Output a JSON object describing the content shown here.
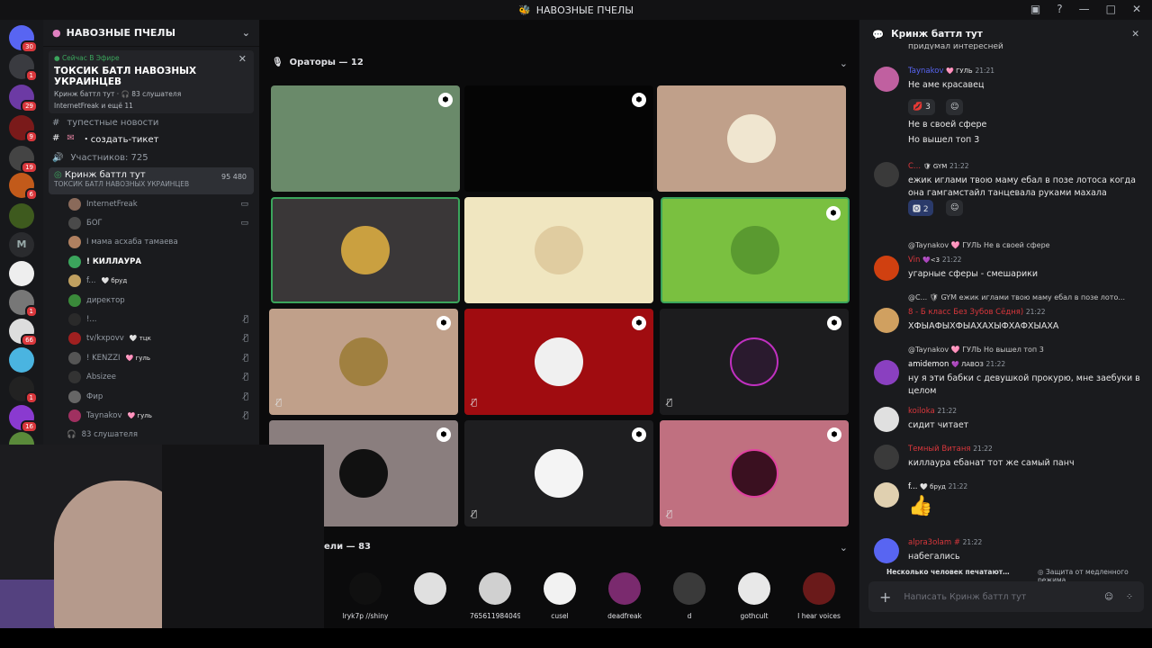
{
  "window": {
    "title": "НАВОЗНЫЕ ПЧЕЛЫ"
  },
  "server": {
    "name": "НАВОЗНЫЕ ПЧЕЛЫ",
    "on_air": "Сейчас В Эфире",
    "stage_title": "ТОКСИК БАТЛ НАВОЗНЫХ УКРАИНЦЕВ",
    "stage_meta": "Кринж баттл тут · 🎧 83 слушателя",
    "stage_users": "InternetFreak и ещё 11"
  },
  "server_badges": [
    "30",
    "1",
    "29",
    "9",
    "19",
    "6",
    "1",
    "66",
    "1",
    "16"
  ],
  "channels": [
    {
      "label": "тупестные новости"
    },
    {
      "label": "・создать-тикет"
    },
    {
      "label": "Участников: 725"
    }
  ],
  "voice_channel": {
    "name": "Кринж баттл тут",
    "sub": "ТОКСИК БАТЛ НАВОЗНЫХ УКРАИНЦЕВ",
    "count": "95  480"
  },
  "voice_users": [
    {
      "name": "InternetFreak",
      "tag": "",
      "right": "▭"
    },
    {
      "name": "БОГ",
      "tag": "",
      "right": "▭"
    },
    {
      "name": "I мама асхаба тамаева",
      "tag": "",
      "right": ""
    },
    {
      "name": "! КИЛЛАУРА",
      "tag": "",
      "right": ""
    },
    {
      "name": "f...",
      "tag": "🤍 бруд",
      "right": ""
    },
    {
      "name": "директор",
      "tag": "",
      "right": ""
    },
    {
      "name": "!...",
      "tag": "",
      "right": "🎙̸"
    },
    {
      "name": "tv/kxpovv",
      "tag": "🤍 тцк",
      "right": "🎙̸"
    },
    {
      "name": "! KENZZI",
      "tag": "🩷 гуль",
      "right": "🎙̸"
    },
    {
      "name": "Absizee",
      "tag": "",
      "right": "🎙̸"
    },
    {
      "name": "Фир",
      "tag": "",
      "right": "🎙̸"
    },
    {
      "name": "Taynakov",
      "tag": "🩷 гуль",
      "right": "🎙̸"
    }
  ],
  "listeners_row": "83 слушателя",
  "stage": {
    "speakers": "Ораторы — 12",
    "listeners": "ели — 83"
  },
  "listeners": [
    {
      "name": "lryk7p //shiny",
      "color": "#101010"
    },
    {
      "name": "",
      "color": "#e0e0e0"
    },
    {
      "name": "765611984049...",
      "color": "#d0d0d0"
    },
    {
      "name": "cusel",
      "color": "#f2f2f2"
    },
    {
      "name": "deadfreak",
      "color": "#7a2a6e"
    },
    {
      "name": "d",
      "color": "#3a3a3a"
    },
    {
      "name": "gothcult",
      "color": "#e8e8e8"
    },
    {
      "name": "I hear voices",
      "color": "#6a1a1a"
    }
  ],
  "chat": {
    "channel": "Кринж баттл тут",
    "cut_text": "придумал интересней",
    "placeholder": "Написать Кринж баттл тут",
    "typing": "Несколько человек печатают…",
    "slowmode": "Защита от медленного режима",
    "messages": [
      {
        "author": "Taynakov",
        "tag": "🩷 ГУЛЬ",
        "time": "21:21",
        "text": "Не аме красавец",
        "react1": "💋 3",
        "react2": "☺",
        "extra1": "Не в своей сфере",
        "extra2": "Но вышел топ 3",
        "color": "#5865f2"
      },
      {
        "author": "C...",
        "tag": "🛡 GYM",
        "time": "21:22",
        "text": "ежик иглами твою маму ебал в позе лотоса когда она гамгамстайл танцевала руками махала",
        "react1": "🅾 2",
        "react2": "☺",
        "color": "#da373c"
      },
      {
        "reply": "@Taynakov 🩷 ГУЛЬ  Не в своей сфере",
        "author": "Vin",
        "tag": "💜<3",
        "time": "21:22",
        "text": "угарные сферы - смешарики",
        "color": "#da373c"
      },
      {
        "reply": "@C... 🛡 GYM  ежик иглами твою маму ебал в позе лото...",
        "author": "8 - Б класс Без Зубов Сёдня)",
        "tag": "",
        "time": "21:22",
        "text": "ХФЫАФЫХФЫАХАХЫФХАФХЫАХА",
        "color": "#da373c"
      },
      {
        "reply": "@Taynakov 🩷 ГУЛЬ  Но вышел топ 3",
        "author": "amidemon",
        "tag": "💜 ЛАВОЗ",
        "time": "21:22",
        "text": "ну я эти бабки с девушкой прокурю, мне заебуки в целом",
        "color": "#ffffff"
      },
      {
        "author": "koiloka",
        "tag": "",
        "time": "21:22",
        "text": "сидит читает",
        "color": "#da373c"
      },
      {
        "author": "Темный Витаня",
        "tag": "",
        "time": "21:22",
        "text": "киллаура ебанат тот же самый панч",
        "color": "#da373c"
      },
      {
        "author": "f...",
        "tag": "🤍 бруд",
        "time": "21:22",
        "text": "👍",
        "color": "#ffffff"
      },
      {
        "author": "alpra3olam #",
        "tag": "",
        "time": "21:22",
        "text": "набегались",
        "color": "#da373c"
      }
    ]
  },
  "colors": {
    "accent": "#5865f2",
    "live": "#3ba55c",
    "mention": "#da373c"
  }
}
